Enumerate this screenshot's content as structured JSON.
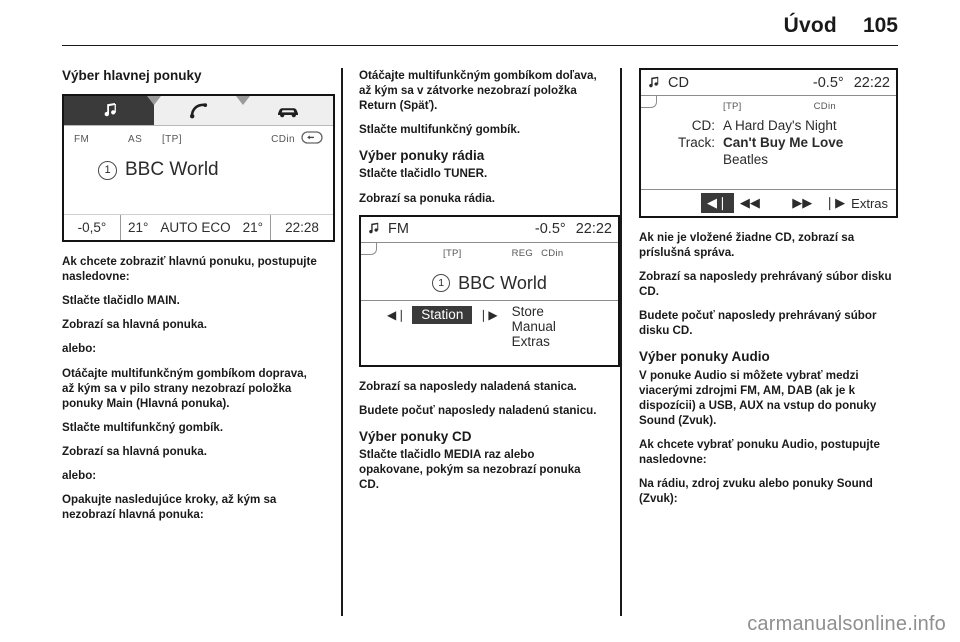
{
  "header": {
    "title": "Úvod",
    "page_number": "105"
  },
  "col1": {
    "heading": "Výber hlavnej ponuky",
    "display": {
      "tabs": [
        {
          "name": "audio-tab",
          "icon": "music-note-icon",
          "active": true
        },
        {
          "name": "phone-tab",
          "icon": "phone-handset-icon",
          "active": false
        },
        {
          "name": "vehicle-tab",
          "icon": "car-icon",
          "active": false
        }
      ],
      "status": {
        "band": "FM",
        "autostore": "AS",
        "tp": "[TP]",
        "cdin": "CDin",
        "loop_icon": "return-loop-icon"
      },
      "preset": "1",
      "station": "BBC World",
      "bottom": {
        "outside_temp": "-0,5°",
        "temp_left": "21°",
        "climate_mode": "AUTO ECO",
        "temp_right": "21°",
        "clock": "22:28"
      }
    },
    "paragraphs": [
      "Ak chcete zobraziť hlavnú ponuku, postupujte nasledovne:",
      "Stlačte tlačidlo MAIN.",
      "Zobrazí sa hlavná ponuka.",
      "alebo:",
      "Otáčajte multifunkčným gombíkom doprava, až kým sa v pilo strany nezobrazí položka ponuky Main (Hlavná ponuka).",
      "Stlačte multifunkčný gombík.",
      "Zobrazí sa hlavná ponuka.",
      "alebo:",
      "Opakujte nasledujúce kroky, až kým sa nezobrazí hlavná ponuka:"
    ]
  },
  "col2": {
    "intro": [
      "Otáčajte multifunkčným gombíkom doľava, až kým sa v zátvorke nezobrazí položka Return (Späť).",
      "Stlačte multifunkčný gombík."
    ],
    "radio_heading": "Výber ponuky rádia",
    "radio_lines": [
      "Stlačte tlačidlo TUNER.",
      "Zobrazí sa ponuka rádia."
    ],
    "display": {
      "note_icon": "music-note-icon",
      "source": "FM",
      "temp": "-0.5°",
      "clock": "22:22",
      "flags": {
        "tp": "[TP]",
        "reg": "REG",
        "cdin": "CDin"
      },
      "preset": "1",
      "station": "BBC World",
      "prev_icon": "skip-previous-icon",
      "next_icon": "skip-next-icon",
      "selected_tile": "Station",
      "menu_items": [
        "Store",
        "Manual",
        "Extras"
      ]
    },
    "after_display": [
      "Zobrazí sa naposledy naladená stanica.",
      "Budete počuť naposledy naladenú stanicu."
    ],
    "cd_heading": "Výber ponuky CD",
    "cd_lines": [
      "Stlačte tlačidlo MEDIA raz alebo opakovane, pokým sa nezobrazí ponuka CD."
    ]
  },
  "col3": {
    "display": {
      "note_icon": "music-note-icon",
      "source": "CD",
      "temp": "-0.5°",
      "clock": "22:22",
      "flags": {
        "tp": "[TP]",
        "cdin": "CDin"
      },
      "cd_label": "CD:",
      "cd_value": "A Hard Day's Night",
      "track_label": "Track:",
      "track_value": "Can't Buy Me Love",
      "artist": "Beatles",
      "controls": [
        {
          "name": "skip-previous-icon",
          "glyph": "◀❘",
          "selected": true
        },
        {
          "name": "rewind-icon",
          "glyph": "◀◀",
          "selected": false
        },
        {
          "name": "fast-forward-icon",
          "glyph": "▶▶",
          "selected": false
        },
        {
          "name": "skip-next-icon",
          "glyph": "❘▶",
          "selected": false
        }
      ],
      "extras_label": "Extras"
    },
    "paragraphs": [
      "Ak nie je vložené žiadne CD, zobrazí sa príslušná správa.",
      "Zobrazí sa naposledy prehrávaný súbor disku CD.",
      "Budete počuť naposledy prehrávaný súbor disku CD."
    ],
    "audio_heading": "Výber ponuky Audio",
    "audio_paragraphs": [
      "V ponuke Audio si môžete vybrať medzi viacerými zdrojmi FM, AM, DAB (ak je k dispozícii) a USB, AUX na vstup do ponuky Sound (Zvuk).",
      "Ak chcete vybrať ponuku Audio, postupujte nasledovne:",
      "Na rádiu, zdroj zvuku alebo ponuky Sound (Zvuk):"
    ]
  },
  "watermark": "carmanualsonline.info"
}
